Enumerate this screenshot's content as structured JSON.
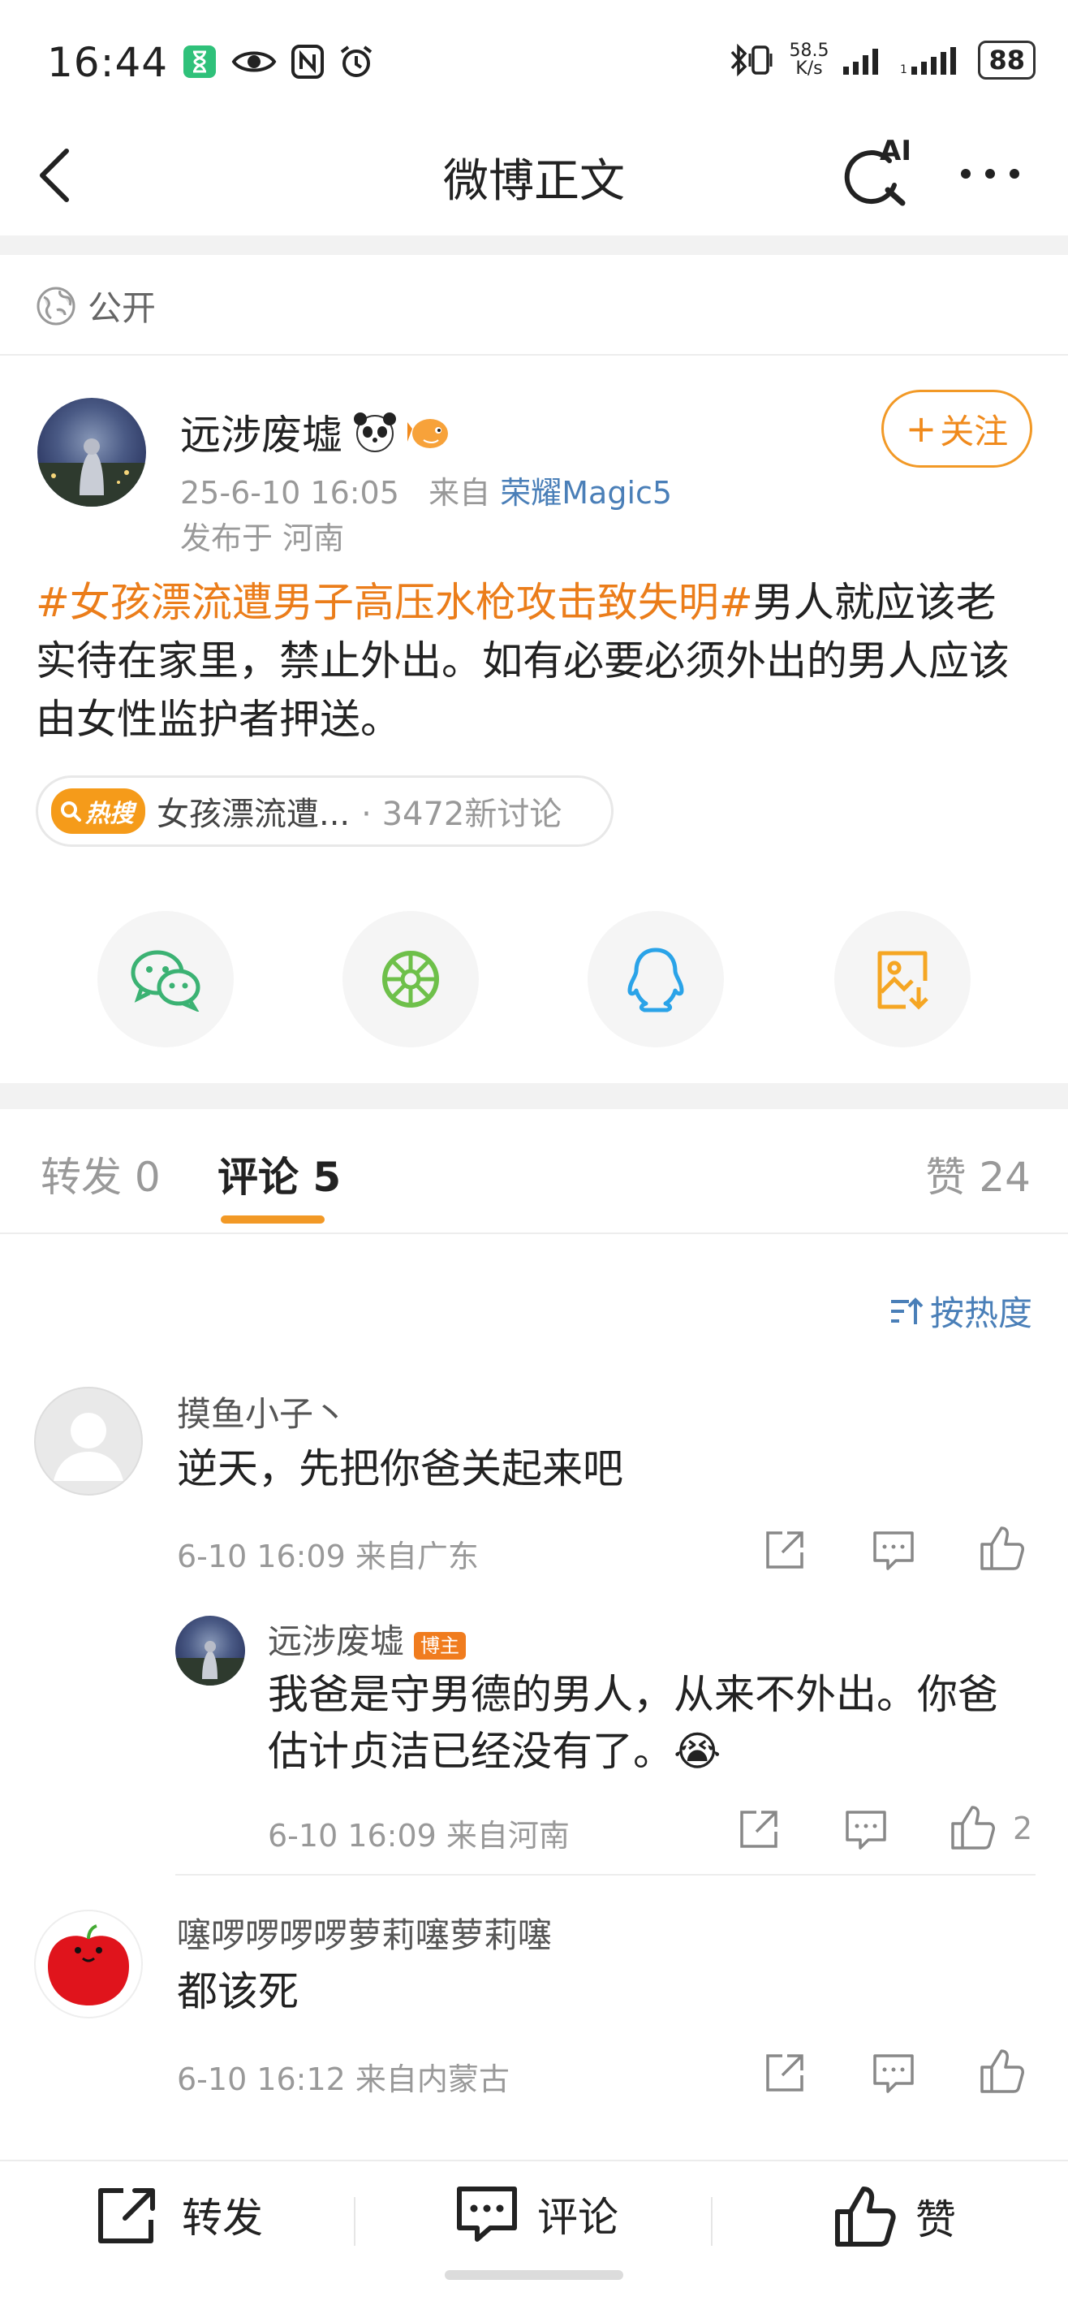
{
  "status_bar": {
    "time": "16:44",
    "net_speed_value": "58.5",
    "net_speed_unit": "K/s",
    "battery": "88"
  },
  "nav": {
    "title": "微博正文",
    "ai_label": "AI"
  },
  "visibility": "公开",
  "post": {
    "author": "远涉废墟",
    "date": "25-6-10 16:05",
    "source_prefix": "来自",
    "source": "荣耀Magic5",
    "location": "发布于 河南",
    "follow_label": "关注",
    "hashtag": "#女孩漂流遭男子高压水枪攻击致失明#",
    "body": "男人就应该老实待在家里，禁止外出。如有必要必须外出的男人应该由女性监护者押送。",
    "hot_badge": "热搜",
    "hot_topic": "女孩漂流遭...",
    "hot_count": "· 3472新讨论"
  },
  "tabs": {
    "repost": "转发 0",
    "comment": "评论 5",
    "like": "赞 24"
  },
  "sort_label": "按热度",
  "comments": [
    {
      "name": "摸鱼小子丶",
      "text": "逆天，先把你爸关起来吧",
      "meta": "6-10 16:09  来自广东"
    },
    {
      "name": "远涉废墟",
      "badge": "博主",
      "text": "我爸是守男德的男人，从来不外出。你爸估计贞洁已经没有了。😭",
      "meta": "6-10 16:09  来自河南",
      "likes": "2"
    },
    {
      "name": "噻啰啰啰啰萝莉噻萝莉噻",
      "text": "都该死",
      "meta": "6-10 16:12  来自内蒙古"
    }
  ],
  "bottom_bar": {
    "repost": "转发",
    "comment": "评论",
    "like": "赞"
  },
  "colors": {
    "accent": "#f29926",
    "hashtag": "#eb7d1a",
    "link": "#4a7fb8"
  }
}
